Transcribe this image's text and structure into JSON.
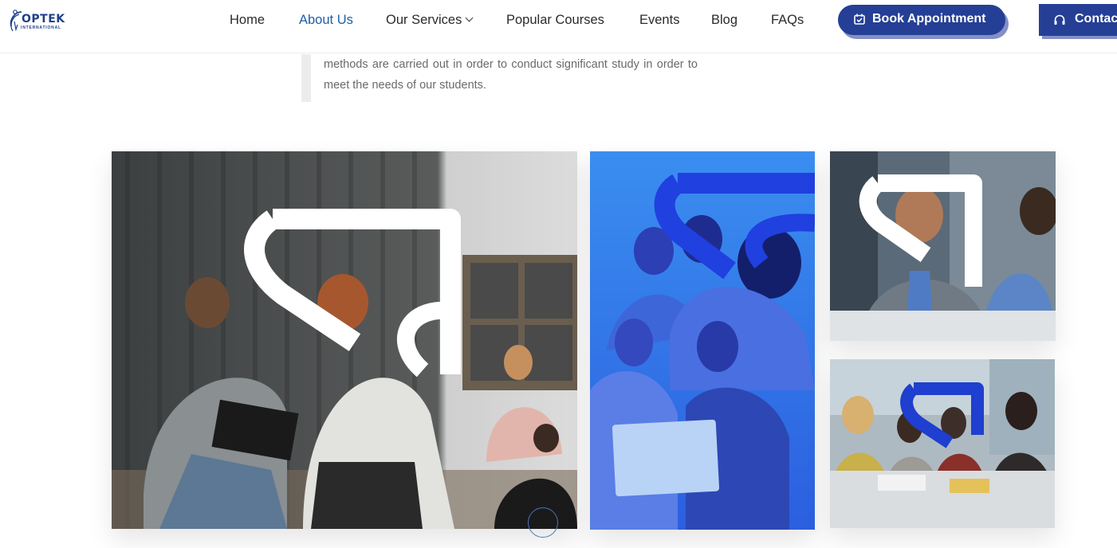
{
  "brand": {
    "name": "OPTEK",
    "tagline": "INTERNATIONAL",
    "logo_icon": "globe-swoosh-logo",
    "color": "#1d3f8c"
  },
  "nav": {
    "items": [
      {
        "label": "Home"
      },
      {
        "label": "About Us",
        "active": true
      },
      {
        "label": "Our Services",
        "has_dropdown": true
      },
      {
        "label": "Popular Courses"
      },
      {
        "label": "Events"
      },
      {
        "label": "Blog"
      },
      {
        "label": "FAQs"
      }
    ],
    "active_color": "#1d5fa8"
  },
  "actions": {
    "book": {
      "label": "Book Appointment",
      "icon": "calendar-check-icon"
    },
    "contact": {
      "label": "Contac",
      "icon": "headset-icon"
    },
    "button_color": "#243f95"
  },
  "content": {
    "paragraph": "methods are carried out in order to conduct significant study in order to meet the needs of our students."
  },
  "gallery": {
    "images": [
      {
        "name": "mentor-session-photo",
        "overlay": "white-brand-mark"
      },
      {
        "name": "student-group-laptop-photo",
        "overlay": "blue-brand-mark"
      },
      {
        "name": "business-meeting-photo",
        "overlay": "white-brand-mark"
      },
      {
        "name": "study-group-table-photo",
        "overlay": "blue-brand-mark"
      }
    ],
    "accent": "#2443c8"
  }
}
